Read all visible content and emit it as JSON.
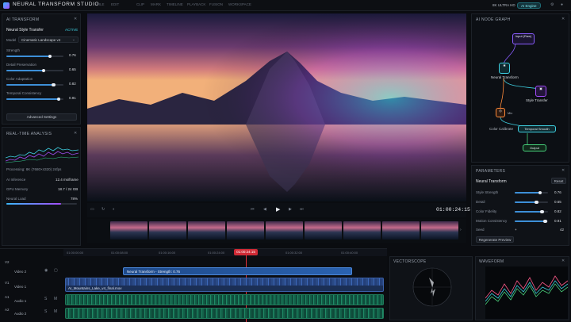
{
  "app": {
    "title": "NEURAL TRANSFORM STUDIO",
    "menu": [
      "FILE",
      "EDIT",
      "CLIP",
      "MARK",
      "TIMELINE",
      "PLAYBACK",
      "FUSION",
      "WORKSPACE"
    ],
    "quality": "8K ULTRA HD",
    "engine": "AI Engine"
  },
  "ai_transform": {
    "title": "AI TRANSFORM",
    "effect": "Neural Style Transfer",
    "status": "ACTIVE",
    "model_label": "Model",
    "model_value": "Cinematic Landscape v4",
    "params": [
      {
        "label": "Strength",
        "value": "0.76",
        "level": 0.76
      },
      {
        "label": "Detail Preservation",
        "value": "0.65",
        "level": 0.65
      },
      {
        "label": "Color Adaptation",
        "value": "0.82",
        "level": 0.82
      },
      {
        "label": "Temporal Consistency",
        "value": "0.91",
        "level": 0.91
      }
    ],
    "advanced": "Advanced Settings"
  },
  "analysis": {
    "title": "REAL-TIME ANALYSIS",
    "processing": "Processing: 8K (7680×4320) 24fps",
    "rows": [
      {
        "label": "AI Inference",
        "value": "12.4 ms/frame"
      },
      {
        "label": "GPU Memory",
        "value": "18.7 / 24 GB"
      },
      {
        "label": "Neural Load",
        "value": "78%"
      }
    ]
  },
  "viewer": {
    "timecode": "01:00:24:15"
  },
  "node_graph": {
    "title": "AI NODE GRAPH",
    "nodes": {
      "input": "Input (Raw)",
      "neural": "Neural Transform",
      "style": "Style Transfer",
      "mix": "Mix",
      "color": "Color Calibrate",
      "temporal": "Temporal Smooth",
      "output": "Output"
    }
  },
  "parameters": {
    "title": "PARAMETERS",
    "node": "Neural Transform",
    "reset": "Reset",
    "rows": [
      {
        "label": "Style Strength",
        "value": "0.76",
        "level": 0.76
      },
      {
        "label": "Detail",
        "value": "0.65",
        "level": 0.65
      },
      {
        "label": "Color Fidelity",
        "value": "0.82",
        "level": 0.82
      },
      {
        "label": "Motion Consistency",
        "value": "0.91",
        "level": 0.91
      }
    ],
    "seed_label": "Seed",
    "seed_value": "42",
    "preview": "Regenerate Preview"
  },
  "timeline": {
    "playhead": "01:00:24:15",
    "ruler": [
      "01:00:00:00",
      "01:00:08:00",
      "01:00:16:00",
      "01:00:24:00",
      "01:00:32:00",
      "01:00:40:00"
    ],
    "tracks": [
      {
        "id": "V2",
        "name": "Video 2"
      },
      {
        "id": "V1",
        "name": "Video 1"
      },
      {
        "id": "A1",
        "name": "Audio 1"
      },
      {
        "id": "A2",
        "name": "Audio 2"
      }
    ],
    "clip_fx": "Neural Transform - Strength: 0.76",
    "clip_video": "AI_Mountains_Lake_v4_final.mov"
  },
  "scopes": {
    "vectorscope": "VECTORSCOPE",
    "waveform": "WAVEFORM"
  }
}
